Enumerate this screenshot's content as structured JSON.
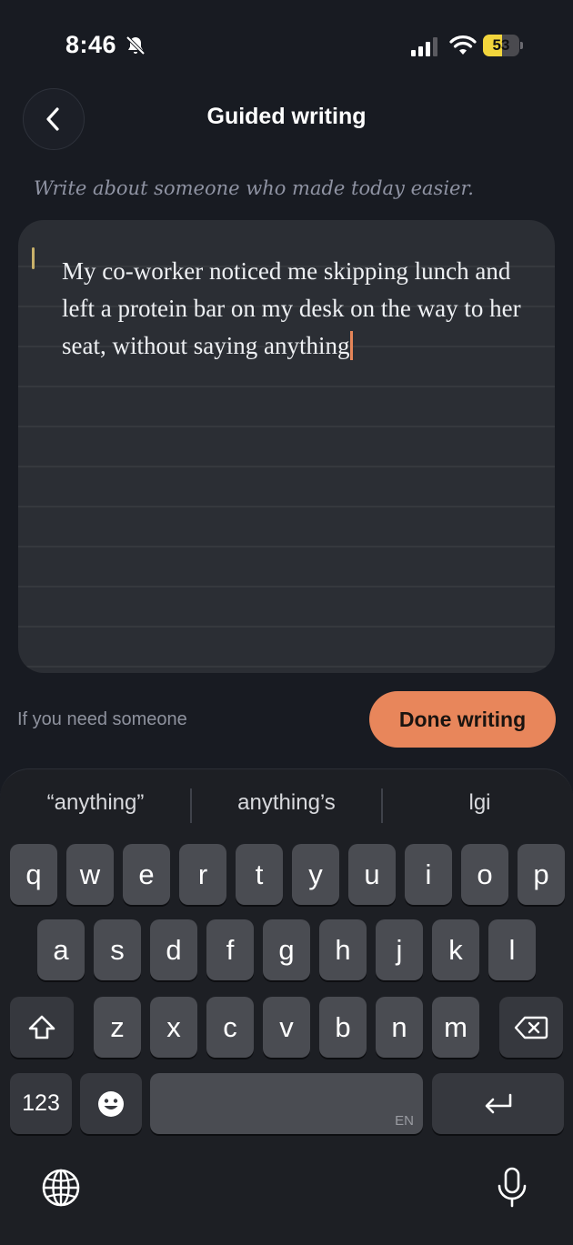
{
  "status_bar": {
    "time": "8:46",
    "battery": "53",
    "battery_level_percent": 53,
    "icons": [
      "bell-slash-icon",
      "cellular-signal-icon",
      "wifi-icon",
      "battery-icon"
    ],
    "battery_color": "#f2d53c"
  },
  "header": {
    "title": "Guided writing",
    "back_icon": "chevron-left-icon"
  },
  "prompt": "Write about someone who made today easier.",
  "editor": {
    "text": "My co-worker noticed me skipping lunch and left a protein bar on my desk on the way to her seat, without saying anything",
    "caret_color": "#e58558"
  },
  "footer": {
    "help_link": "If you need someone",
    "done_button": "Done writing",
    "accent_color": "#e8865b"
  },
  "keyboard": {
    "suggestions": [
      "“anything”",
      "anything’s",
      "lgi"
    ],
    "row1": [
      "q",
      "w",
      "e",
      "r",
      "t",
      "y",
      "u",
      "i",
      "o",
      "p"
    ],
    "row2": [
      "a",
      "s",
      "d",
      "f",
      "g",
      "h",
      "j",
      "k",
      "l"
    ],
    "row3": [
      "z",
      "x",
      "c",
      "v",
      "b",
      "n",
      "m"
    ],
    "numbers_key": "123",
    "space_lang": "EN",
    "icons": [
      "shift-icon",
      "backspace-icon",
      "emoji-icon",
      "return-icon",
      "globe-icon",
      "microphone-icon"
    ]
  }
}
